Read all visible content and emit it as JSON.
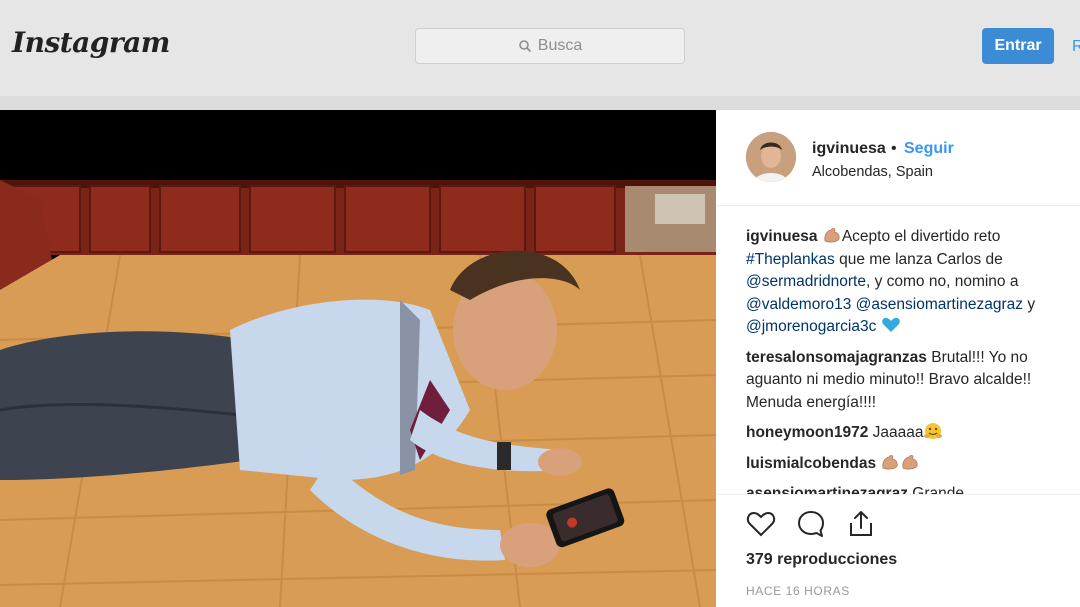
{
  "header": {
    "logo": "Instagram",
    "search_placeholder": "Busca",
    "login_label": "Entrar",
    "register_partial": "R"
  },
  "post": {
    "author": "igvinuesa",
    "dot": "•",
    "follow_label": "Seguir",
    "location": "Alcobendas, Spain",
    "caption": {
      "user": "igvinuesa",
      "text_1": "Acepto el divertido reto",
      "hashtag": "#Theplankas",
      "text_2": " que me lanza Carlos de",
      "mention_1": "@sermadridnorte",
      "text_3": ", y como no, nomino a",
      "mention_2": "@valdemoro13",
      "mention_3": "@asensiomartinezagraz",
      "text_4": " y",
      "mention_4": "@jmorenogarcia3c"
    },
    "comments": [
      {
        "user": "teresalonsomajagranzas",
        "text": "Brutal!!! Yo no aguanto ni medio minuto!! Bravo alcalde!! Menuda energía!!!!"
      },
      {
        "user": "honeymoon1972",
        "text": "Jaaaaa"
      },
      {
        "user": "luismialcobendas",
        "text": ""
      },
      {
        "user": "asensiomartinezagraz",
        "text": "Grande"
      }
    ],
    "views": "379 reproducciones",
    "time": "HACE 16 HORAS"
  },
  "colors": {
    "accent": "#3897f0",
    "button": "#3b8cd4",
    "mention": "#003569"
  }
}
